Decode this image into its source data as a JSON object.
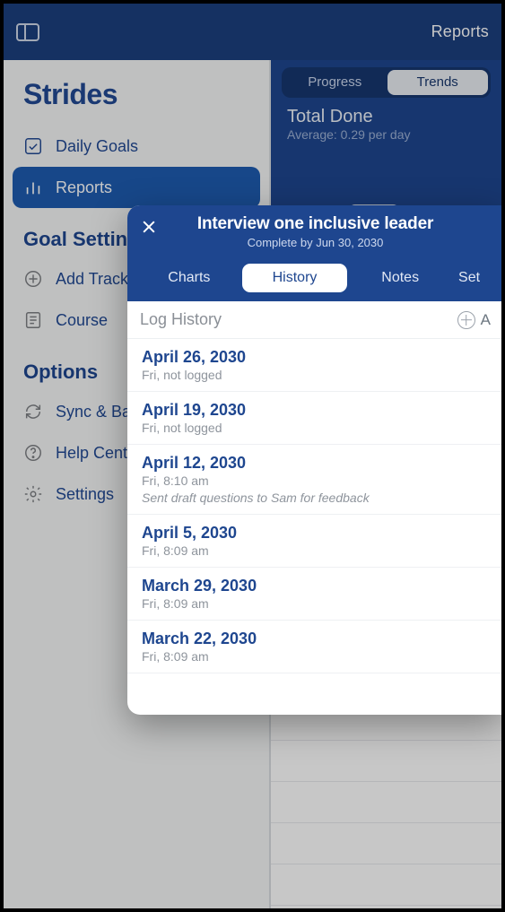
{
  "topbar": {
    "right_label": "Reports"
  },
  "sidebar": {
    "app_title": "Strides",
    "items": [
      {
        "label": "Daily Goals"
      },
      {
        "label": "Reports"
      }
    ],
    "section_goal": "Goal Setting",
    "goal_items": [
      {
        "label": "Add Tracker"
      },
      {
        "label": "Course"
      }
    ],
    "section_options": "Options",
    "option_items": [
      {
        "label": "Sync & Backup"
      },
      {
        "label": "Help Center"
      },
      {
        "label": "Settings"
      }
    ]
  },
  "content": {
    "segments": {
      "progress": "Progress",
      "trends": "Trends"
    },
    "metric_title": "Total Done",
    "metric_sub": "Average: 0.29 per day"
  },
  "sheet": {
    "title": "Interview one inclusive leader",
    "subtitle": "Complete by Jun 30, 2030",
    "tabs": {
      "charts": "Charts",
      "history": "History",
      "notes": "Notes",
      "settings": "Set"
    },
    "bar_title": "Log History",
    "add_label": "A",
    "logs": [
      {
        "date": "April 26, 2030",
        "sub": "Fri, not logged",
        "note": ""
      },
      {
        "date": "April 19, 2030",
        "sub": "Fri, not logged",
        "note": ""
      },
      {
        "date": "April 12, 2030",
        "sub": "Fri, 8:10 am",
        "note": "Sent draft questions to Sam for feedback"
      },
      {
        "date": "April 5, 2030",
        "sub": "Fri, 8:09 am",
        "note": ""
      },
      {
        "date": "March 29, 2030",
        "sub": "Fri, 8:09 am",
        "note": ""
      },
      {
        "date": "March 22, 2030",
        "sub": "Fri, 8:09 am",
        "note": ""
      }
    ]
  }
}
